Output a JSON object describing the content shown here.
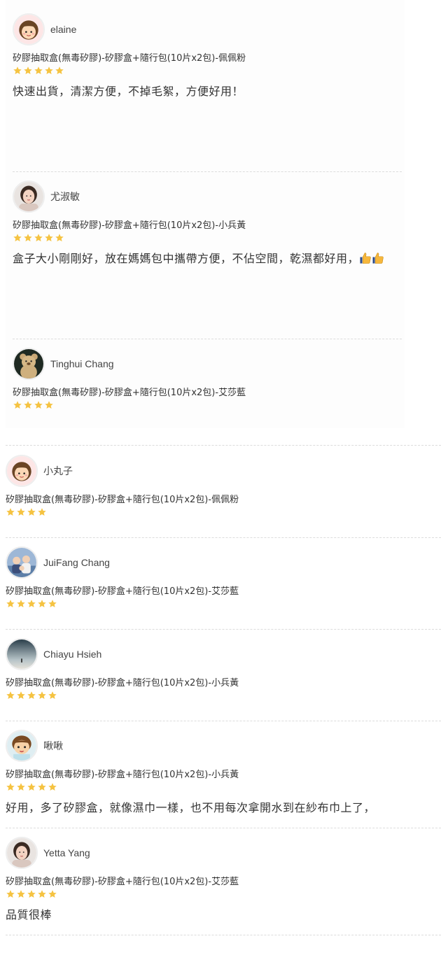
{
  "reviews": [
    {
      "name": "elaine",
      "avatar": "girl-cartoon-avatar",
      "variant": "矽膠抽取盒(無毒矽膠)-矽膠盒+隨行包(10片x2包)-佩佩粉",
      "rating": 5,
      "comment": "快速出貨，清潔方便，不掉毛絮，方便好用！"
    },
    {
      "name": "尤淑敏",
      "avatar": "woman-photo-avatar",
      "variant": "矽膠抽取盒(無毒矽膠)-矽膠盒+隨行包(10片x2包)-小兵黃",
      "rating": 5,
      "comment": "盒子大小剛剛好，放在媽媽包中攜帶方便，不佔空間，乾濕都好用，",
      "comment_emoji": "thumbs-up-icon"
    },
    {
      "name": "Tinghui Chang",
      "avatar": "teddy-bear-avatar",
      "variant": "矽膠抽取盒(無毒矽膠)-矽膠盒+隨行包(10片x2包)-艾莎藍",
      "rating": 4,
      "comment": ""
    },
    {
      "name": "小丸子",
      "avatar": "girl-cartoon-avatar",
      "variant": "矽膠抽取盒(無毒矽膠)-矽膠盒+隨行包(10片x2包)-佩佩粉",
      "rating": 4,
      "comment": ""
    },
    {
      "name": "JuiFang Chang",
      "avatar": "family-photo-avatar",
      "variant": "矽膠抽取盒(無毒矽膠)-矽膠盒+隨行包(10片x2包)-艾莎藍",
      "rating": 5,
      "comment": ""
    },
    {
      "name": "Chiayu Hsieh",
      "avatar": "landscape-photo-avatar",
      "variant": "矽膠抽取盒(無毒矽膠)-矽膠盒+隨行包(10片x2包)-小兵黃",
      "rating": 5,
      "comment": ""
    },
    {
      "name": "啾啾",
      "avatar": "boy-cartoon-avatar",
      "variant": "矽膠抽取盒(無毒矽膠)-矽膠盒+隨行包(10片x2包)-小兵黃",
      "rating": 5,
      "comment": "好用，多了矽膠盒，就像濕巾一樣，也不用每次拿開水到在紗布巾上了，"
    },
    {
      "name": "Yetta Yang",
      "avatar": "woman-photo-avatar",
      "variant": "矽膠抽取盒(無毒矽膠)-矽膠盒+隨行包(10片x2包)-艾莎藍",
      "rating": 5,
      "comment": "品質很棒"
    }
  ],
  "colors": {
    "star": "#f5c342",
    "separator": "#dcdcdc",
    "text": "#333333"
  }
}
